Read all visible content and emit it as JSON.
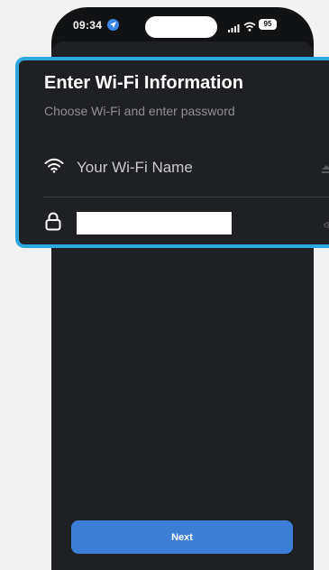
{
  "status_bar": {
    "time": "09:34",
    "battery": "95"
  },
  "sheet": {
    "close_symbol": "×",
    "next_label": "Next"
  },
  "wifi_form": {
    "title": "Enter Wi-Fi Information",
    "subtitle": "Choose Wi-Fi and enter password",
    "wifi_name_placeholder": "Your Wi-Fi Name",
    "password_value": ""
  },
  "icons": {
    "location": "location-arrow-icon",
    "signal": "cellular-signal-icon",
    "wifi_status": "wifi-icon",
    "battery": "battery-icon",
    "close": "close-icon",
    "wifi_field": "wifi-icon",
    "dropdown": "eject-icon",
    "lock": "lock-icon",
    "reveal": "eye-icon"
  },
  "colors": {
    "highlight_border": "#2fa8df",
    "primary_button": "#3d7fd6",
    "sheet_background": "#1f2023",
    "phone_background": "#111214"
  }
}
